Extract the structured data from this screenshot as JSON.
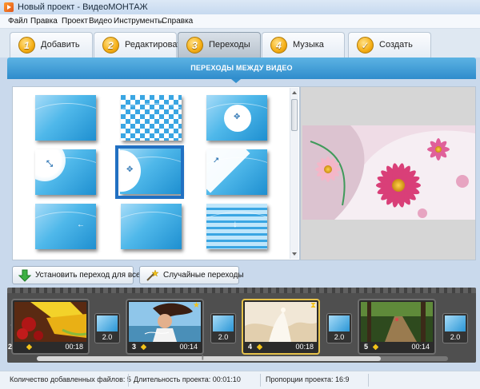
{
  "window": {
    "title": "Новый проект - ВидеоМОНТАЖ"
  },
  "menu": [
    "Файл",
    "Правка",
    "Проект",
    "Видео",
    "Инструменты",
    "Справка"
  ],
  "tabs": [
    {
      "number": "1",
      "label": "Добавить",
      "active": false
    },
    {
      "number": "2",
      "label": "Редактировать",
      "active": false
    },
    {
      "number": "3",
      "label": "Переходы",
      "active": true
    },
    {
      "number": "4",
      "label": "Музыка",
      "active": false
    },
    {
      "number": "",
      "label": "Создать",
      "active": false
    }
  ],
  "transitions": {
    "header": "ПЕРЕХОДЫ МЕЖДУ ВИДЕО",
    "items": [
      {
        "icon": "wave-transition-icon"
      },
      {
        "icon": "checker-transition-icon"
      },
      {
        "icon": "circle-zoom-transition-icon"
      },
      {
        "icon": "corner-circle-transition-icon"
      },
      {
        "icon": "side-circle-transition-icon",
        "selected": true
      },
      {
        "icon": "diagonal-wipe-transition-icon"
      },
      {
        "icon": "arrow-left-transition-icon"
      },
      {
        "icon": "fade-transition-icon"
      },
      {
        "icon": "blinds-down-transition-icon"
      }
    ]
  },
  "buttons": {
    "apply_all": "Установить переход для всех",
    "random": "Случайные переходы"
  },
  "timeline": {
    "clips": [
      {
        "number": "2",
        "duration": "00:18",
        "selected": false
      },
      {
        "number": "3",
        "duration": "00:14",
        "selected": false
      },
      {
        "number": "4",
        "duration": "00:18",
        "selected": true
      },
      {
        "number": "5",
        "duration": "00:14",
        "selected": false
      }
    ],
    "transitions": [
      "2.0",
      "2.0",
      "2.0",
      "2.0"
    ]
  },
  "status": {
    "files": "Количество добавленных файлов: 5",
    "duration": "Длительность проекта:  00:01:10",
    "aspect": "Пропорции проекта:  16:9"
  }
}
